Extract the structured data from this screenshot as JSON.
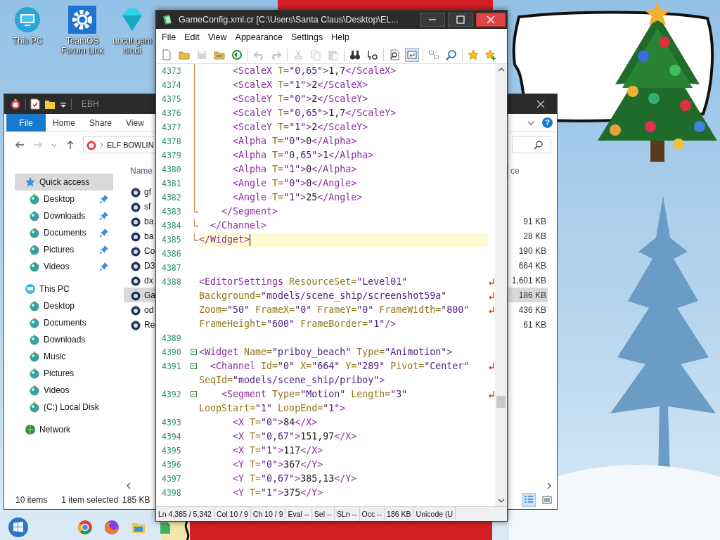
{
  "desktop_icons": [
    {
      "kind": "computer",
      "label": "This PC"
    },
    {
      "kind": "settings",
      "label": "TeamOS Forum Link"
    },
    {
      "kind": "gem",
      "label": "uncut gem hindi"
    }
  ],
  "explorer": {
    "title": "EBH",
    "file_button": "File",
    "ribbon_tabs": [
      {
        "label": "Home",
        "selected": false
      },
      {
        "label": "Share",
        "selected": false
      },
      {
        "label": "View",
        "selected": false
      }
    ],
    "help": "?",
    "address": "ELF BOWLIN",
    "nav": [
      {
        "kind": "quick-access",
        "label": "Quick access",
        "selected": true,
        "children": [
          {
            "label": "Desktop",
            "pinned": true,
            "selected": false
          },
          {
            "label": "Downloads",
            "pinned": true,
            "selected": false
          },
          {
            "label": "Documents",
            "pinned": true,
            "selected": false
          },
          {
            "label": "Pictures",
            "pinned": true,
            "selected": false
          },
          {
            "label": "Videos",
            "pinned": true,
            "selected": false
          }
        ]
      },
      {
        "kind": "computer",
        "label": "This PC",
        "selected": false,
        "children": [
          {
            "label": "Desktop",
            "pinned": false,
            "selected": false
          },
          {
            "label": "Documents",
            "pinned": false,
            "selected": false
          },
          {
            "label": "Downloads",
            "pinned": false,
            "selected": false
          },
          {
            "label": "Music",
            "pinned": false,
            "selected": false
          },
          {
            "label": "Pictures",
            "pinned": false,
            "selected": false
          },
          {
            "label": "Videos",
            "pinned": false,
            "selected": false
          },
          {
            "label": "(C:) Local Disk",
            "pinned": false,
            "selected": false
          }
        ]
      },
      {
        "kind": "network",
        "label": "Network",
        "selected": false
      }
    ],
    "columns": {
      "column_1": "Name",
      "column_2": "ce"
    },
    "files": [
      {
        "name": "gf",
        "selected": false
      },
      {
        "name": "sf",
        "selected": false
      },
      {
        "name": "ba",
        "size": "91 KB",
        "selected": false
      },
      {
        "name": "ba",
        "size": "28 KB",
        "selected": false
      },
      {
        "name": "Co",
        "size": "190 KB",
        "selected": false
      },
      {
        "name": "D3",
        "size": "664 KB",
        "selected": false
      },
      {
        "name": "dx",
        "size": "1,601 KB",
        "selected": false
      },
      {
        "name": "Ga",
        "size": "186 KB",
        "selected": true
      },
      {
        "name": "od",
        "size": "436 KB",
        "selected": false
      },
      {
        "name": "Re",
        "size": "61 KB",
        "selected": false
      }
    ],
    "status": {
      "count": "10 items",
      "selection": "1 item selected",
      "size": "185 KB"
    }
  },
  "editor": {
    "title": "GameConfig.xml.cr [C:\\Users\\Santa Claus\\Desktop\\EL...",
    "menu": [
      "File",
      "Edit",
      "View",
      "Appearance",
      "Settings",
      "Help"
    ],
    "toolbar": [
      {
        "kind": "new",
        "disabled": false,
        "pressed": false
      },
      {
        "kind": "open",
        "disabled": false,
        "pressed": false
      },
      {
        "kind": "save",
        "disabled": true,
        "pressed": false
      },
      {
        "kind": "save-all",
        "disabled": false,
        "pressed": false
      },
      {
        "kind": "reload",
        "disabled": false,
        "pressed": false
      },
      {
        "kind": "separator"
      },
      {
        "kind": "undo",
        "disabled": true,
        "pressed": false
      },
      {
        "kind": "redo",
        "disabled": true,
        "pressed": false
      },
      {
        "kind": "separator"
      },
      {
        "kind": "cut",
        "disabled": true,
        "pressed": false
      },
      {
        "kind": "copy",
        "disabled": true,
        "pressed": false
      },
      {
        "kind": "paste",
        "disabled": true,
        "pressed": false
      },
      {
        "kind": "separator"
      },
      {
        "kind": "find",
        "disabled": false,
        "pressed": false
      },
      {
        "kind": "replace",
        "disabled": false,
        "pressed": false
      },
      {
        "kind": "separator"
      },
      {
        "kind": "find-files",
        "disabled": false,
        "pressed": false
      },
      {
        "kind": "word-wrap",
        "disabled": false,
        "pressed": true
      },
      {
        "kind": "separator"
      },
      {
        "kind": "split",
        "disabled": false,
        "pressed": false
      },
      {
        "kind": "zoom",
        "disabled": false,
        "pressed": false
      },
      {
        "kind": "separator"
      },
      {
        "kind": "favorite",
        "disabled": false,
        "pressed": false
      },
      {
        "kind": "add-favorite",
        "disabled": false,
        "pressed": false
      }
    ],
    "lines": [
      {
        "number": "4373",
        "kind": "in-fold",
        "current": false,
        "rows": [
          "      <ScaleX T=\"0,65\">1,7</ScaleX>"
        ]
      },
      {
        "number": "4374",
        "kind": "in-fold",
        "current": false,
        "rows": [
          "      <ScaleX T=\"1\">2</ScaleX>"
        ]
      },
      {
        "number": "4375",
        "kind": "in-fold",
        "current": false,
        "rows": [
          "      <ScaleY T=\"0\">2</ScaleY>"
        ]
      },
      {
        "number": "4376",
        "kind": "in-fold",
        "current": false,
        "rows": [
          "      <ScaleY T=\"0,65\">1,7</ScaleY>"
        ]
      },
      {
        "number": "4377",
        "kind": "in-fold",
        "current": false,
        "rows": [
          "      <ScaleY T=\"1\">2</ScaleY>"
        ]
      },
      {
        "number": "4378",
        "kind": "in-fold",
        "current": false,
        "rows": [
          "      <Alpha T=\"0\">0</Alpha>"
        ]
      },
      {
        "number": "4379",
        "kind": "in-fold",
        "current": false,
        "rows": [
          "      <Alpha T=\"0,65\">1</Alpha>"
        ]
      },
      {
        "number": "4380",
        "kind": "in-fold",
        "current": false,
        "rows": [
          "      <Alpha T=\"1\">0</Alpha>"
        ]
      },
      {
        "number": "4381",
        "kind": "in-fold",
        "current": false,
        "rows": [
          "      <Angle T=\"0\">0</Angle>"
        ]
      },
      {
        "number": "4382",
        "kind": "in-fold",
        "current": false,
        "rows": [
          "      <Angle T=\"1\">25</Angle>"
        ]
      },
      {
        "number": "4383",
        "kind": "fold-end",
        "current": false,
        "rows": [
          "    </Segment>"
        ]
      },
      {
        "number": "4384",
        "kind": "fold-end",
        "current": false,
        "rows": [
          "  </Channel>"
        ]
      },
      {
        "number": "4385",
        "kind": "fold-end",
        "current": true,
        "rows": [
          "</Widget>"
        ]
      },
      {
        "number": "4386",
        "kind": "plain",
        "current": false
      },
      {
        "number": "4387",
        "kind": "plain",
        "current": false
      },
      {
        "number": "4388",
        "kind": "plain",
        "current": false,
        "rows": [
          "<EditorSettings ResourceSet=\"Level01\"",
          "Background=\"models/scene_ship/screenshot59a\"",
          "Zoom=\"50\" FrameX=\"0\" FrameY=\"0\" FrameWidth=\"800\"",
          "FrameHeight=\"600\" FrameBorder=\"1\"/>"
        ]
      },
      {
        "number": "4389",
        "kind": "plain",
        "current": false
      },
      {
        "number": "4390",
        "kind": "fold-start",
        "current": false,
        "rows": [
          "<Widget Name=\"priboy_beach\" Type=\"Animotion\">"
        ]
      },
      {
        "number": "4391",
        "kind": "fold-start",
        "current": false,
        "rows": [
          "  <Channel Id=\"0\" X=\"664\" Y=\"289\" Pivot=\"Center\"",
          "SeqId=\"models/scene_ship/priboy\">"
        ]
      },
      {
        "number": "4392",
        "kind": "fold-start",
        "current": false,
        "rows": [
          "    <Segment Type=\"Motion\" Length=\"3\"",
          "LoopStart=\"1\" LoopEnd=\"1\">"
        ]
      },
      {
        "number": "4393",
        "kind": "plain",
        "current": false,
        "rows": [
          "      <X T=\"0\">84</X>"
        ]
      },
      {
        "number": "4394",
        "kind": "plain",
        "current": false,
        "rows": [
          "      <X T=\"0,67\">151,97</X>"
        ]
      },
      {
        "number": "4395",
        "kind": "plain",
        "current": false,
        "rows": [
          "      <X T=\"1\">117</X>"
        ]
      },
      {
        "number": "4396",
        "kind": "plain",
        "current": false,
        "rows": [
          "      <Y T=\"0\">367</Y>"
        ]
      },
      {
        "number": "4397",
        "kind": "plain",
        "current": false,
        "rows": [
          "      <Y T=\"0,67\">385,13</Y>"
        ]
      },
      {
        "number": "4398",
        "kind": "plain",
        "current": false,
        "rows": [
          "      <Y T=\"1\">375</Y>"
        ]
      }
    ],
    "status": [
      "Ln 4,385 / 5,342",
      "Col 10 / 9",
      "Ch 10 / 9",
      "Eval --",
      "Sel --",
      "SLn --",
      "Occ --",
      "186 KB",
      "Unicode (U"
    ]
  }
}
